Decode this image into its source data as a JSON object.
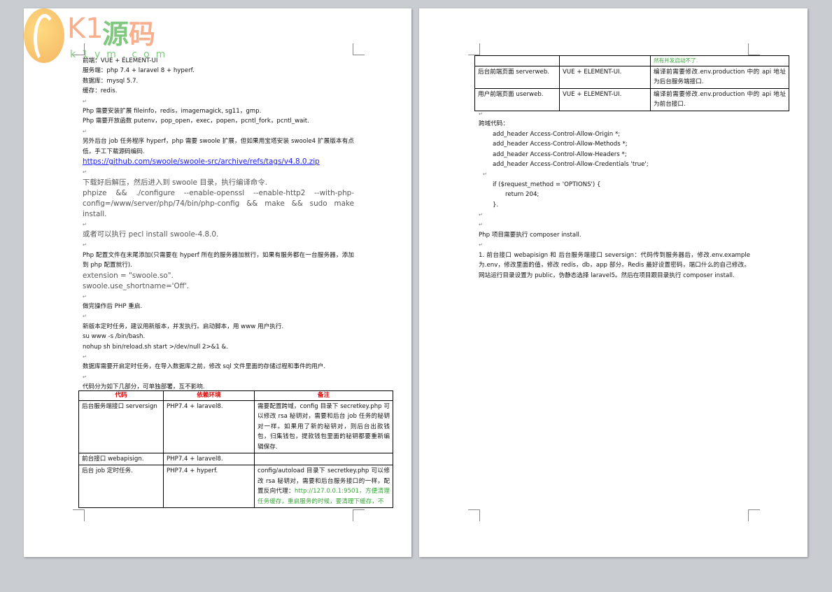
{
  "logo": {
    "k1": "K1",
    "cn1": "源",
    "cn2": "码",
    "url": "k1ym.com"
  },
  "page1": {
    "lines": [
      "前端：VUE + ELEMENT-UI",
      "服务端：php 7.4 + laravel 8 + hyperf.",
      "数据库：mysql 5.7.",
      "缓存：redis.",
      "Php 需要安装扩展 fileinfo，redis，imagemagick, sg11，gmp.",
      "Php 需要开放函数 putenv，pop_open，exec，popen，pcntl_fork，pcntl_wait.",
      "另外后台 job 任务程序 hyperf，php 需要 swoole 扩展，但如果用宝塔安装 swoole4 扩展版本有点低，手工下载源码编码.",
      "https://github.com/swoole/swoole-src/archive/refs/tags/v4.8.0.zip",
      "下载好后解压，然后进入到 swoole 目录，执行编译命令.",
      "phpize && ./configure --enable-openssl --enable-http2 --with-php-config=/www/server/php/74/bin/php-config && make && sudo make install.",
      "或者可以执行  pecl install swoole-4.8.0.",
      "Php 配置文件在末尾添加(只需要在 hyperf 所在的服务器加就行，如果有服务都在一台服务器，添加到 php 配置就行).",
      "extension = \"swoole.so\".",
      "swoole.use_shortname='Off'.",
      "做完操作后 PHP 重启.",
      "新版本定时任务，建议用新版本，并发执行。启动脚本，用 www 用户执行.",
      "su www -s /bin/bash.",
      "nohup sh bin/reload.sh start >/dev/null 2>&1 &.",
      "数据库需要开启定时任务，在导入数据库之前，修改 sql 文件里面的存储过程和事件的用户.",
      "代码分为如下几部分，可单独部署，互不影响."
    ],
    "table": {
      "headers": [
        "代码",
        "依赖环境",
        "备注"
      ],
      "rows": [
        [
          "后台服务端接口 serversign",
          "PHP7.4 + laravel8.",
          "需要配置跨域，config 目录下 secretkey.php 可以修改 rsa 秘钥对，需要和后台 job 任务的秘钥对一样。如果用了新的秘钥对，则后台出款钱包，归集钱包，提款钱包里面的秘钥都要重新编辑保存."
        ],
        [
          "前台接口 webapisign.",
          "PHP7.4 + laravel8.",
          ""
        ],
        [
          "后台 job 定时任务.",
          "PHP7.4 + hyperf.",
          "config/autoload 目录下 secretkey.php 可以修改 rsa 秘钥对，需要和后台服务接口的一样，配置反向代理："
        ]
      ],
      "note_green": "http://127.0.0.1:9501，方便清理任务缓存，重启服务的时候，要清理下缓存，不"
    }
  },
  "page2": {
    "table": {
      "cont_green": "然有并发启动不了.",
      "rows": [
        [
          "后台前端页面 serverweb.",
          "VUE + ELEMENT-UI.",
          "编译前需要修改.env.production 中的 api 地址为后台服务端接口."
        ],
        [
          "用户前端页面 userweb.",
          "VUE + ELEMENT-UI.",
          "编译前需要修改.env.production 中的 api 地址为前台接口."
        ]
      ]
    },
    "cors_title": "跨域代码：",
    "cors_lines": [
      "add_header Access-Control-Allow-Origin *;",
      "add_header Access-Control-Allow-Methods *;",
      "add_header Access-Control-Allow-Headers *;",
      "add_header Access-Control-Allow-Credentials 'true';"
    ],
    "if_line": "if ($request_method = 'OPTIONS') {",
    "return_line": "return 204;",
    "close_brace": "}.",
    "composer": "Php 项目需要执行 composer install.",
    "step1": "1. 前台接口 webapisign  和  后台服务端接口 seversign：代码传到服务器后，修改.env.example 为.env，修改里面的值，修改 redis，db，app 部分。Redis 最好设置密码，端口什么的自己修改。 网站运行目录设置为 public，伪静态选择 laravel5。然后在项目跟目录执行 composer install."
  },
  "para_mark": "↵"
}
